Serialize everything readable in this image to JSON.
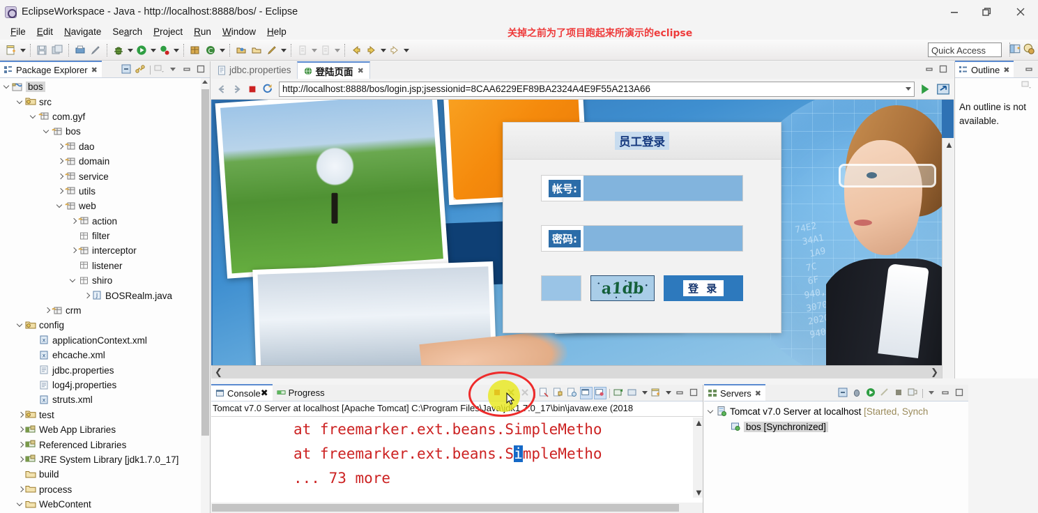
{
  "window": {
    "title": "EclipseWorkspace - Java - http://localhost:8888/bos/ - Eclipse",
    "icon": "eclipse-icon",
    "minimize_label": "Minimize",
    "restore_label": "Restore",
    "close_label": "Close"
  },
  "menu": {
    "items": [
      {
        "label": "File"
      },
      {
        "label": "Edit"
      },
      {
        "label": "Navigate"
      },
      {
        "label": "Search"
      },
      {
        "label": "Project"
      },
      {
        "label": "Run"
      },
      {
        "label": "Window"
      },
      {
        "label": "Help"
      }
    ]
  },
  "annotation": {
    "red_text": "关掉之前为了项目跑起来所演示的eclipse",
    "red_color": "#ee3b3b",
    "highlight_color": "#e8e81e",
    "circle_color": "#ee2b2b"
  },
  "toolbar": {
    "quick_access_placeholder": "Quick Access",
    "quick_access_value": "Quick Access"
  },
  "package_explorer": {
    "tab_label": "Package Explorer",
    "tree": [
      {
        "label": "bos",
        "indent": 0,
        "twist": "open",
        "icon": "java-project-icon",
        "selected": true
      },
      {
        "label": "src",
        "indent": 1,
        "twist": "open",
        "icon": "source-folder-icon"
      },
      {
        "label": "com.gyf",
        "indent": 2,
        "twist": "open",
        "icon": "package-icon"
      },
      {
        "label": "bos",
        "indent": 3,
        "twist": "open",
        "icon": "package-icon"
      },
      {
        "label": "dao",
        "indent": 4,
        "twist": "closed",
        "icon": "package-icon"
      },
      {
        "label": "domain",
        "indent": 4,
        "twist": "closed",
        "icon": "package-icon"
      },
      {
        "label": "service",
        "indent": 4,
        "twist": "closed",
        "icon": "package-icon"
      },
      {
        "label": "utils",
        "indent": 4,
        "twist": "closed",
        "icon": "package-icon"
      },
      {
        "label": "web",
        "indent": 4,
        "twist": "open",
        "icon": "package-icon"
      },
      {
        "label": "action",
        "indent": 5,
        "twist": "closed",
        "icon": "package-icon"
      },
      {
        "label": "filter",
        "indent": 5,
        "twist": "none",
        "icon": "empty-package-icon"
      },
      {
        "label": "interceptor",
        "indent": 5,
        "twist": "closed",
        "icon": "package-icon"
      },
      {
        "label": "listener",
        "indent": 5,
        "twist": "none",
        "icon": "empty-package-icon"
      },
      {
        "label": "shiro",
        "indent": 5,
        "twist": "open",
        "icon": "empty-package-icon"
      },
      {
        "label": "BOSRealm.java",
        "indent": 6,
        "twist": "closed",
        "icon": "java-file-icon"
      },
      {
        "label": "crm",
        "indent": 3,
        "twist": "closed",
        "icon": "package-icon"
      },
      {
        "label": "config",
        "indent": 1,
        "twist": "open",
        "icon": "source-folder-icon"
      },
      {
        "label": "applicationContext.xml",
        "indent": 2,
        "twist": "none",
        "icon": "xml-file-icon"
      },
      {
        "label": "ehcache.xml",
        "indent": 2,
        "twist": "none",
        "icon": "xml-file-icon"
      },
      {
        "label": "jdbc.properties",
        "indent": 2,
        "twist": "none",
        "icon": "properties-file-icon"
      },
      {
        "label": "log4j.properties",
        "indent": 2,
        "twist": "none",
        "icon": "properties-file-icon"
      },
      {
        "label": "struts.xml",
        "indent": 2,
        "twist": "none",
        "icon": "xml-file-icon"
      },
      {
        "label": "test",
        "indent": 1,
        "twist": "closed",
        "icon": "source-folder-icon"
      },
      {
        "label": "Web App Libraries",
        "indent": 1,
        "twist": "closed",
        "icon": "library-icon"
      },
      {
        "label": "Referenced Libraries",
        "indent": 1,
        "twist": "closed",
        "icon": "library-icon"
      },
      {
        "label": "JRE System Library",
        "suffix": "[jdk1.7.0_17]",
        "indent": 1,
        "twist": "closed",
        "icon": "library-icon"
      },
      {
        "label": "build",
        "indent": 1,
        "twist": "none",
        "icon": "folder-icon"
      },
      {
        "label": "process",
        "indent": 1,
        "twist": "closed",
        "icon": "folder-icon"
      },
      {
        "label": "WebContent",
        "indent": 1,
        "twist": "open",
        "icon": "folder-icon"
      }
    ]
  },
  "editor": {
    "tabs": [
      {
        "label": "jdbc.properties",
        "active": false,
        "icon": "properties-file-icon",
        "closeable": false
      },
      {
        "label": "登陆页面",
        "active": true,
        "icon": "web-browser-icon",
        "closeable": true
      }
    ],
    "url": "http://localhost:8888/bos/login.jsp;jsessionid=8CAA6229EF89BA2324A4E9F55A213A66"
  },
  "login_page": {
    "title": "员工登录",
    "account_label": "帐号:",
    "account_value": "",
    "password_label": "密码:",
    "password_value": "",
    "captcha_value": "",
    "captcha_text": "a1db",
    "submit_label": "登 录"
  },
  "console": {
    "tabs": [
      {
        "label": "Console",
        "active": true,
        "icon": "console-icon",
        "closeable": true
      },
      {
        "label": "Progress",
        "active": false,
        "icon": "progress-icon",
        "closeable": false
      }
    ],
    "process_line": "Tomcat v7.0 Server at localhost [Apache Tomcat] C:\\Program Files\\Java\\jdk1.7.0_17\\bin\\javaw.exe (2018",
    "lines": [
      {
        "pre": "at freemarker.ext.beans.SimpleMetho",
        "sel": "",
        "post": ""
      },
      {
        "pre": "at freemarker.ext.beans.S",
        "sel": "i",
        "post": "mpleMetho"
      },
      {
        "pre": "... 73 more",
        "sel": "",
        "post": ""
      }
    ],
    "text_color": "#cc2222",
    "selection_color": "#1569c7"
  },
  "servers": {
    "tab_label": "Servers",
    "rows": [
      {
        "label": "Tomcat v7.0 Server at localhost",
        "status": "[Started, Synch",
        "indent": 0,
        "twist": "open",
        "icon": "server-icon",
        "selected": false
      },
      {
        "label": "bos",
        "status": "[Synchronized]",
        "indent": 1,
        "twist": "none",
        "icon": "module-icon",
        "selected": true
      }
    ]
  },
  "outline": {
    "tab_label": "Outline",
    "message": "An outline is not available."
  }
}
